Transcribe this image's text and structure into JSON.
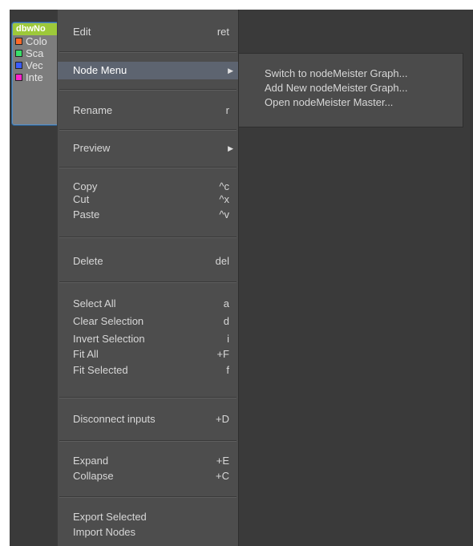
{
  "node": {
    "title": "dbwNo",
    "ports": [
      {
        "label": "Colo",
        "color": "#ff6a2a"
      },
      {
        "label": "Sca",
        "color": "#39e06a"
      },
      {
        "label": "Vec",
        "color": "#3a5cff"
      },
      {
        "label": "Inte",
        "color": "#ff22cc"
      }
    ]
  },
  "menu": {
    "edit": {
      "label": "Edit",
      "shortcut": "ret"
    },
    "node_menu": {
      "label": "Node Menu"
    },
    "rename": {
      "label": "Rename",
      "shortcut": "r"
    },
    "preview": {
      "label": "Preview"
    },
    "copy": {
      "label": "Copy",
      "shortcut": "^c"
    },
    "cut": {
      "label": "Cut",
      "shortcut": "^x"
    },
    "paste": {
      "label": "Paste",
      "shortcut": "^v"
    },
    "delete": {
      "label": "Delete",
      "shortcut": "del"
    },
    "select_all": {
      "label": "Select All",
      "shortcut": "a"
    },
    "clear_selection": {
      "label": "Clear Selection",
      "shortcut": "d"
    },
    "invert_selection": {
      "label": "Invert Selection",
      "shortcut": "i"
    },
    "fit_all": {
      "label": "Fit All",
      "shortcut": "+F"
    },
    "fit_selected": {
      "label": "Fit Selected",
      "shortcut": "f"
    },
    "disconnect_inputs": {
      "label": "Disconnect inputs",
      "shortcut": "+D"
    },
    "expand": {
      "label": "Expand",
      "shortcut": "+E"
    },
    "collapse": {
      "label": "Collapse",
      "shortcut": "+C"
    },
    "export_selected": {
      "label": "Export Selected"
    },
    "import_nodes": {
      "label": "Import Nodes"
    }
  },
  "submenu": {
    "switch": "Switch to nodeMeister Graph...",
    "add": "Add New nodeMeister Graph...",
    "open": "Open nodeMeister Master..."
  },
  "icons": {
    "submenu_arrow": "submenu-arrow-icon"
  }
}
